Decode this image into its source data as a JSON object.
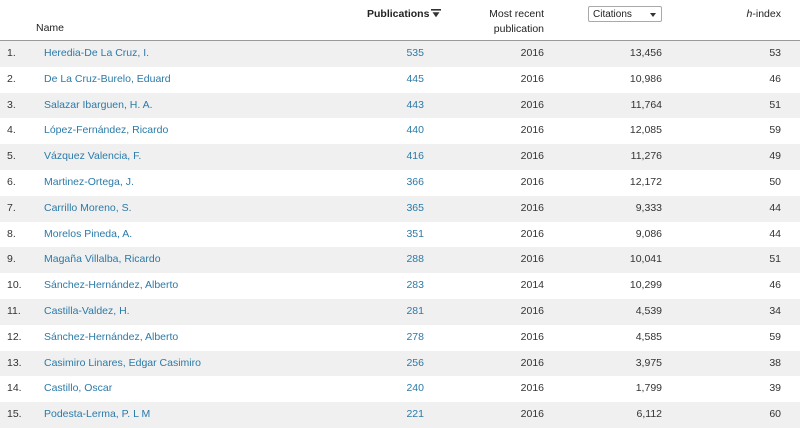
{
  "header": {
    "name": "Name",
    "publications": "Publications",
    "most_recent_line1": "Most recent",
    "most_recent_line2": "publication",
    "citations_select": "Citations",
    "h_index_prefix": "h",
    "h_index_suffix": "-index"
  },
  "rows": [
    {
      "rank": "1.",
      "name": "Heredia-De La Cruz, I.",
      "publications": "535",
      "year": "2016",
      "citations": "13,456",
      "h_index": "53"
    },
    {
      "rank": "2.",
      "name": "De La Cruz-Burelo, Eduard",
      "publications": "445",
      "year": "2016",
      "citations": "10,986",
      "h_index": "46"
    },
    {
      "rank": "3.",
      "name": "Salazar Ibarguen, H. A.",
      "publications": "443",
      "year": "2016",
      "citations": "11,764",
      "h_index": "51"
    },
    {
      "rank": "4.",
      "name": "López-Fernández, Ricardo",
      "publications": "440",
      "year": "2016",
      "citations": "12,085",
      "h_index": "59"
    },
    {
      "rank": "5.",
      "name": "Vázquez Valencia, F.",
      "publications": "416",
      "year": "2016",
      "citations": "11,276",
      "h_index": "49"
    },
    {
      "rank": "6.",
      "name": "Martinez-Ortega, J.",
      "publications": "366",
      "year": "2016",
      "citations": "12,172",
      "h_index": "50"
    },
    {
      "rank": "7.",
      "name": "Carrillo Moreno, S.",
      "publications": "365",
      "year": "2016",
      "citations": "9,333",
      "h_index": "44"
    },
    {
      "rank": "8.",
      "name": "Morelos Pineda, A.",
      "publications": "351",
      "year": "2016",
      "citations": "9,086",
      "h_index": "44"
    },
    {
      "rank": "9.",
      "name": "Magaña Villalba, Ricardo",
      "publications": "288",
      "year": "2016",
      "citations": "10,041",
      "h_index": "51"
    },
    {
      "rank": "10.",
      "name": "Sánchez-Hernández, Alberto",
      "publications": "283",
      "year": "2014",
      "citations": "10,299",
      "h_index": "46"
    },
    {
      "rank": "11.",
      "name": "Castilla-Valdez, H.",
      "publications": "281",
      "year": "2016",
      "citations": "4,539",
      "h_index": "34"
    },
    {
      "rank": "12.",
      "name": "Sánchez-Hernández, Alberto",
      "publications": "278",
      "year": "2016",
      "citations": "4,585",
      "h_index": "59"
    },
    {
      "rank": "13.",
      "name": "Casimiro Linares, Edgar Casimiro",
      "publications": "256",
      "year": "2016",
      "citations": "3,975",
      "h_index": "38"
    },
    {
      "rank": "14.",
      "name": "Castillo, Oscar",
      "publications": "240",
      "year": "2016",
      "citations": "1,799",
      "h_index": "39"
    },
    {
      "rank": "15.",
      "name": "Podesta-Lerma, P. L M",
      "publications": "221",
      "year": "2016",
      "citations": "6,112",
      "h_index": "60"
    }
  ],
  "colors": {
    "link": "#2b7aa8",
    "row_stripe": "#f0f0f0",
    "header_rule": "#9a9a9a"
  },
  "icons": {
    "sort": "filter-sort-icon",
    "select": "chevron-down-icon"
  }
}
